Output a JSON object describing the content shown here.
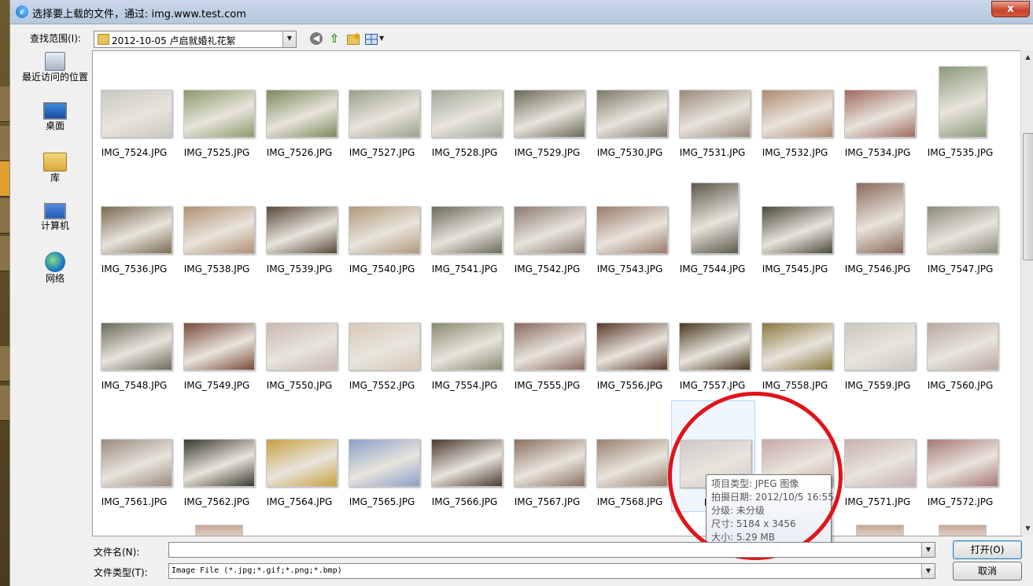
{
  "window": {
    "title": "选择要上载的文件，通过: img.www.test.com",
    "close_label": "x"
  },
  "toolbar": {
    "lookin_label": "查找范围(I):",
    "lookin_value": "2012-10-05 卢启就婚礼花絮",
    "back_icon": "back-arrow-icon",
    "up_icon": "up-folder-icon",
    "new_folder_icon": "new-folder-icon",
    "view_menu_icon": "view-menu-icon"
  },
  "places": [
    {
      "label": "最近访问的位置",
      "icon": "recent-places-icon"
    },
    {
      "label": "桌面",
      "icon": "desktop-icon"
    },
    {
      "label": "库",
      "icon": "libraries-icon"
    },
    {
      "label": "计算机",
      "icon": "computer-icon"
    },
    {
      "label": "网络",
      "icon": "network-icon"
    }
  ],
  "files": [
    [
      "IMG_7524.JPG",
      "IMG_7525.JPG",
      "IMG_7526.JPG",
      "IMG_7527.JPG",
      "IMG_7528.JPG",
      "IMG_7529.JPG",
      "IMG_7530.JPG",
      "IMG_7531.JPG",
      "IMG_7532.JPG",
      "IMG_7534.JPG",
      "IMG_7535.JPG"
    ],
    [
      "IMG_7536.JPG",
      "IMG_7538.JPG",
      "IMG_7539.JPG",
      "IMG_7540.JPG",
      "IMG_7541.JPG",
      "IMG_7542.JPG",
      "IMG_7543.JPG",
      "IMG_7544.JPG",
      "IMG_7545.JPG",
      "IMG_7546.JPG",
      "IMG_7547.JPG"
    ],
    [
      "IMG_7548.JPG",
      "IMG_7549.JPG",
      "IMG_7550.JPG",
      "IMG_7552.JPG",
      "IMG_7554.JPG",
      "IMG_7555.JPG",
      "IMG_7556.JPG",
      "IMG_7557.JPG",
      "IMG_7558.JPG",
      "IMG_7559.JPG",
      "IMG_7560.JPG"
    ],
    [
      "IMG_7561.JPG",
      "IMG_7562.JPG",
      "IMG_7564.JPG",
      "IMG_7565.JPG",
      "IMG_7566.JPG",
      "IMG_7567.JPG",
      "IMG_7568.JPG",
      "IMG",
      "IMG_7570.JPG",
      "IMG_7571.JPG",
      "IMG_7572.JPG"
    ]
  ],
  "thumb_colors": [
    [
      "#c8c8c0",
      "#8a9a6a",
      "#7a8a5a",
      "#9aa08a",
      "#a0a898",
      "#6a6a58",
      "#7a7a6a",
      "#9a8a7a",
      "#b08a70",
      "#a06a60",
      "#8a9a7a"
    ],
    [
      "#7a6a50",
      "#b09070",
      "#5a4a3a",
      "#b09878",
      "#6a6a5a",
      "#8a7a70",
      "#9a7a6a",
      "#5a5a4a",
      "#4a4a3a",
      "#8a6a5a",
      "#8a8a7a"
    ],
    [
      "#6a6a5a",
      "#7a4a3a",
      "#c8b8b0",
      "#d8c8b8",
      "#8a8a70",
      "#8a6a60",
      "#5a3a2a",
      "#4a3a20",
      "#8a7a40",
      "#c8c8c0",
      "#b8a8a0"
    ],
    [
      "#9a8a80",
      "#3a3a30",
      "#c8a040",
      "#8aa0c8",
      "#4a3a30",
      "#8a7060",
      "#9a8070",
      "#d0c8c8",
      "#c8a8a8",
      "#c8b0b0",
      "#a87878"
    ]
  ],
  "portrait_cells": [
    "0-10",
    "1-7",
    "1-9"
  ],
  "tooltip": {
    "type": "项目类型: JPEG 图像",
    "date": "拍摄日期: 2012/10/5 16:55",
    "rating": "分级: 未分级",
    "dimensions": "尺寸: 5184 x 3456",
    "size": "大小: 5.29 MB"
  },
  "bottom": {
    "filename_label": "文件名(N):",
    "filename_value": "",
    "filetype_label": "文件类型(T):",
    "filetype_value": "Image File (*.jpg;*.gif;*.png;*.bmp)",
    "open_label": "打开(O)",
    "cancel_label": "取消"
  }
}
